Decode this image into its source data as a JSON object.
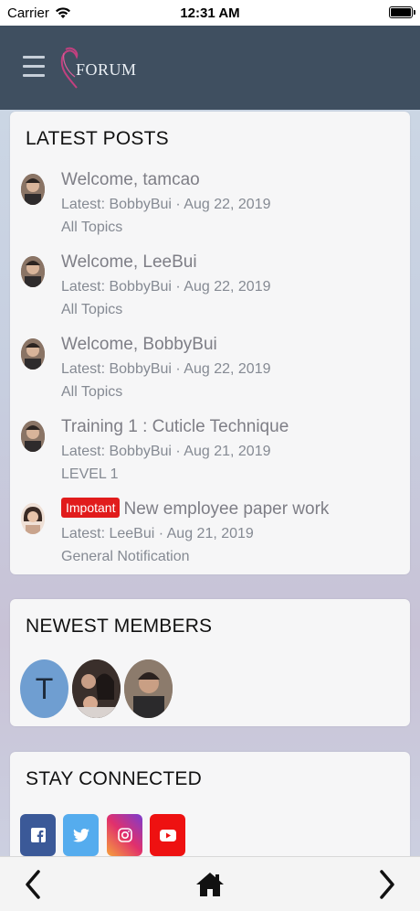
{
  "status_bar": {
    "carrier": "Carrier",
    "time": "12:31 AM"
  },
  "header": {
    "logo_text": "FORUM"
  },
  "latest_posts": {
    "heading": "LATEST POSTS",
    "items": [
      {
        "title": "Welcome, tamcao",
        "meta": "Latest: BobbyBui · Aug 22, 2019",
        "forum": "All Topics"
      },
      {
        "title": "Welcome, LeeBui",
        "meta": "Latest: BobbyBui · Aug 22, 2019",
        "forum": "All Topics"
      },
      {
        "title": "Welcome, BobbyBui",
        "meta": "Latest: BobbyBui · Aug 22, 2019",
        "forum": "All Topics"
      },
      {
        "title": "Training 1 : Cuticle Technique",
        "meta": "Latest: BobbyBui · Aug 21, 2019",
        "forum": "LEVEL 1"
      },
      {
        "badge": "Impotant",
        "title": "New employee paper work",
        "meta": "Latest: LeeBui · Aug 21, 2019",
        "forum": "General Notification"
      }
    ]
  },
  "newest_members": {
    "heading": "NEWEST MEMBERS",
    "first_initial": "T"
  },
  "stay_connected": {
    "heading": "STAY CONNECTED",
    "icons": [
      "facebook-icon",
      "twitter-icon",
      "instagram-icon",
      "youtube-icon"
    ]
  },
  "colors": {
    "header_bg": "#3f4f60",
    "badge_red": "#e11c1c",
    "facebook": "#3b5998",
    "twitter": "#55acee",
    "youtube": "#ee1111"
  }
}
